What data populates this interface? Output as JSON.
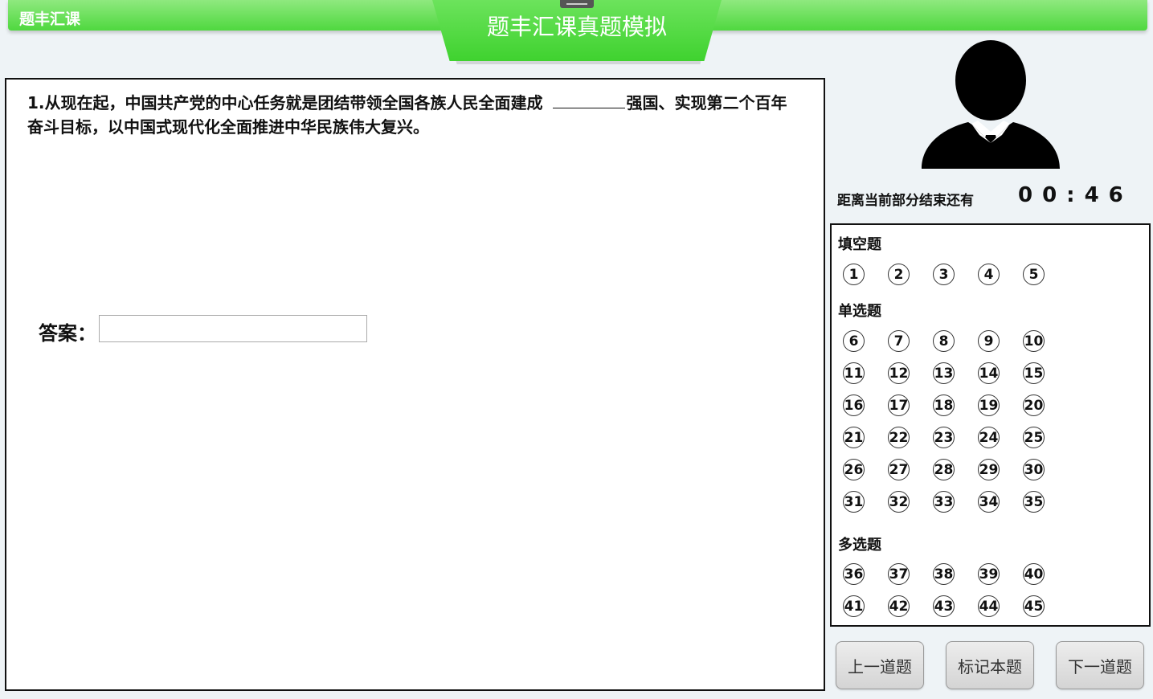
{
  "header": {
    "brand": "题丰汇课",
    "title": "题丰汇课真题模拟"
  },
  "question": {
    "number_prefix": "1.",
    "text_part1": "从现在起，中国共产党的中心任务就是团结带领全国各族人民全面建成",
    "text_part2": "强国、实现第二个百年奋斗目标，以中国式现代化全面推进中华民族伟大复兴。",
    "answer_label": "答案：",
    "answer_value": ""
  },
  "timer": {
    "label": "距离当前部分结束还有",
    "value": "00:46"
  },
  "sections": [
    {
      "title": "填空题",
      "numbers": [
        "1",
        "2",
        "3",
        "4",
        "5"
      ]
    },
    {
      "title": "单选题",
      "numbers": [
        "6",
        "7",
        "8",
        "9",
        "10",
        "11",
        "12",
        "13",
        "14",
        "15",
        "16",
        "17",
        "18",
        "19",
        "20",
        "21",
        "22",
        "23",
        "24",
        "25",
        "26",
        "27",
        "28",
        "29",
        "30",
        "31",
        "32",
        "33",
        "34",
        "35"
      ]
    },
    {
      "title": "多选题",
      "numbers": [
        "36",
        "37",
        "38",
        "39",
        "40",
        "41",
        "42",
        "43",
        "44",
        "45"
      ]
    }
  ],
  "buttons": {
    "prev": "上一道题",
    "mark": "标记本题",
    "next": "下一道题"
  },
  "colors": {
    "accent_green": "#4fd83f",
    "background": "#eef3f6"
  }
}
